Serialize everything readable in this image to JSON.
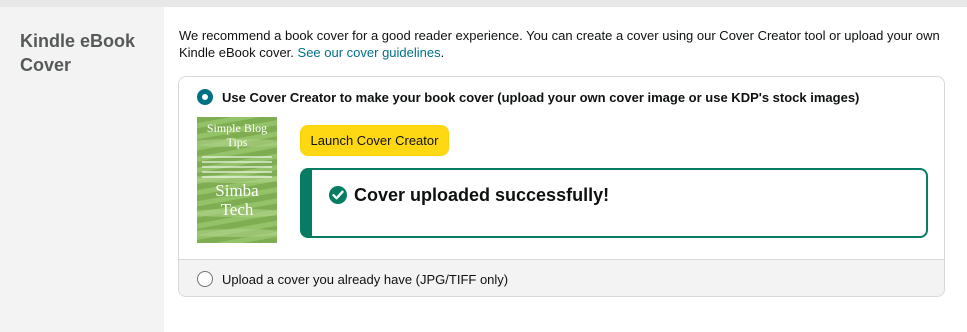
{
  "section": {
    "title": "Kindle eBook Cover"
  },
  "intro": {
    "text": "We recommend a book cover for a good reader experience. You can create a cover using our Cover Creator tool or upload your own Kindle eBook cover.",
    "link_label": "See our cover guidelines",
    "suffix": "."
  },
  "options": {
    "cover_creator": {
      "label": "Use Cover Creator to make your book cover (upload your own cover image or use KDP's stock images)",
      "selected": true
    },
    "upload": {
      "label": "Upload a cover you already have (JPG/TIFF only)",
      "selected": false
    }
  },
  "cover_preview": {
    "title": "Simple Blog Tips",
    "author": "Simba Tech"
  },
  "launch_button": {
    "label": "Launch Cover Creator"
  },
  "status": {
    "message": "Cover uploaded successfully!",
    "icon": "check-circle-icon"
  },
  "colors": {
    "accent": "#007185",
    "button": "#ffd814",
    "success": "#067d62",
    "panel": "#f3f3f3"
  }
}
